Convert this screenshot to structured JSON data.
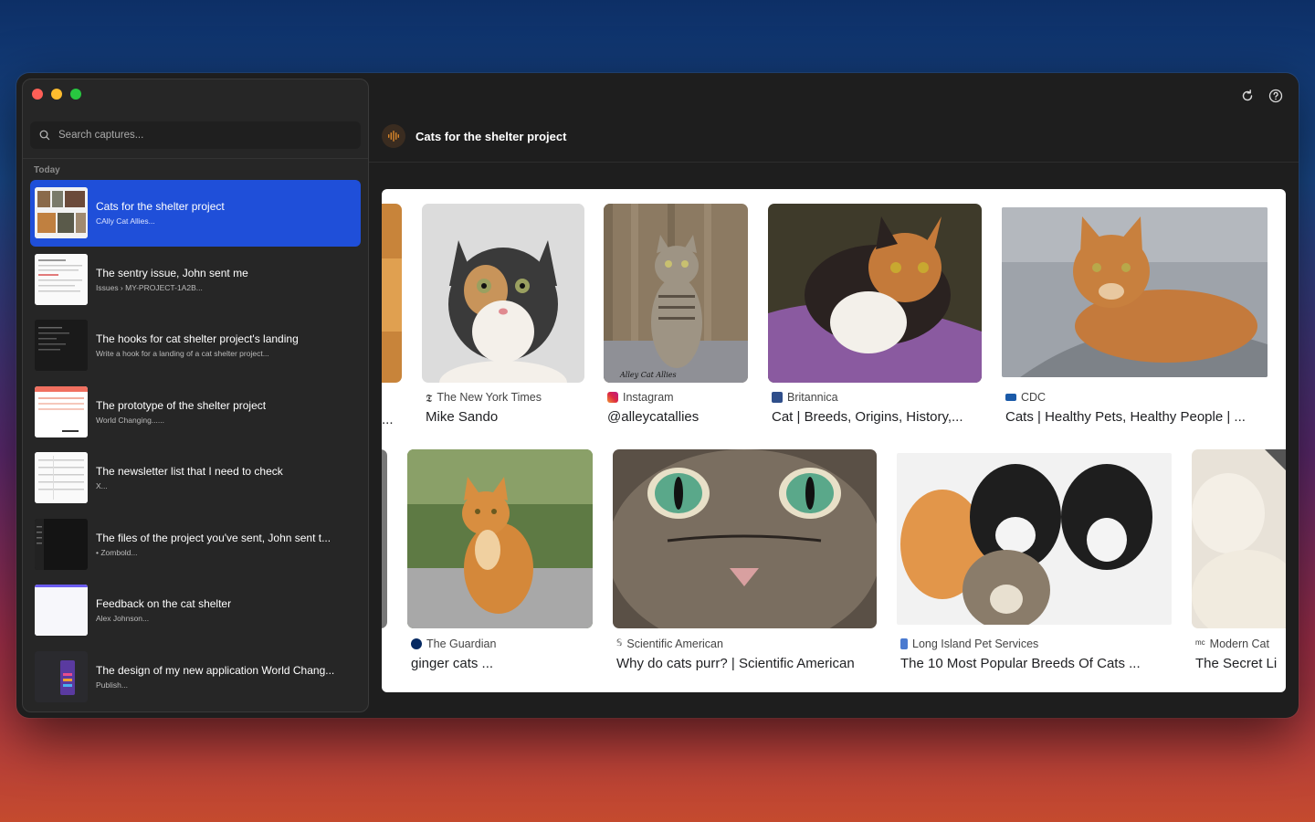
{
  "sidebar": {
    "search_placeholder": "Search captures...",
    "section_label": "Today",
    "items": [
      {
        "title": "Cats for the shelter project",
        "subtitle": "CAlly Cat Allies..."
      },
      {
        "title": "The sentry issue, John sent me",
        "subtitle": "Issues › MY-PROJECT-1A2B..."
      },
      {
        "title": "The hooks for cat shelter project's landing",
        "subtitle": "Write a hook for a landing of a cat shelter project..."
      },
      {
        "title": "The prototype of the shelter project",
        "subtitle": "World Changing......"
      },
      {
        "title": "The newsletter list that I need to check",
        "subtitle": "X..."
      },
      {
        "title": "The files of the project you've sent, John sent t...",
        "subtitle": "• Zombold..."
      },
      {
        "title": "Feedback on the cat shelter",
        "subtitle": "Alex Johnson..."
      },
      {
        "title": "The design of my new application World Chang...",
        "subtitle": "Publish..."
      }
    ]
  },
  "header": {
    "title": "Cats for the shelter project"
  },
  "results_row1": [
    {
      "source": "",
      "caption": "..."
    },
    {
      "source": "The New York Times",
      "caption": "Mike Sando"
    },
    {
      "source": "Instagram",
      "caption": "@alleycatallies",
      "watermark": "Alley Cat Allies"
    },
    {
      "source": "Britannica",
      "caption": "Cat | Breeds, Origins, History,..."
    },
    {
      "source": "CDC",
      "caption": "Cats | Healthy Pets, Healthy People | ..."
    }
  ],
  "results_row2": [
    {
      "source": "The Guardian",
      "caption": "ginger cats ..."
    },
    {
      "source": "Scientific American",
      "caption": "Why do cats purr? | Scientific American"
    },
    {
      "source": "Long Island Pet Services",
      "caption": "The 10 Most Popular Breeds Of Cats ..."
    },
    {
      "source": "Modern Cat",
      "caption": "The Secret Li"
    }
  ],
  "colors": {
    "accent": "#1f4fd9",
    "bg": "#1e1e1e"
  }
}
